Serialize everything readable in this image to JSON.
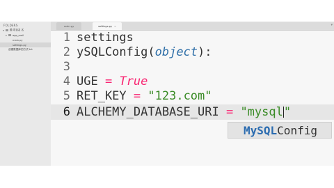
{
  "sidebar": {
    "title": "FOLDERS",
    "rows": [
      {
        "label": "题 项目名 名",
        "level": 0,
        "expanded": true
      },
      {
        "label": "app_mail",
        "level": 1,
        "expanded": true
      },
      {
        "label": "main.py",
        "level": 2
      },
      {
        "label": "settings.py",
        "level": 2,
        "selected": true
      },
      {
        "label": "创建数据库的方式.txt",
        "level": 1
      }
    ]
  },
  "tabs": [
    {
      "label": "main.py",
      "active": false
    },
    {
      "label": "settings.py",
      "active": true
    }
  ],
  "tab_close_glyph": "×",
  "tabbar_arrow_glyph": "▾",
  "editor": {
    "line_numbers": [
      "1",
      "2",
      "3",
      "4",
      "5",
      "6"
    ],
    "current_line": "6",
    "lines": {
      "l1": "settings",
      "l2_name": "ySQLConfig",
      "l2_paren_open": "(",
      "l2_param": "object",
      "l2_paren_close": "):",
      "l4_name": "UGE ",
      "l4_op": "=",
      "l4_value": "True",
      "l5_name": "RET_KEY ",
      "l5_op": "=",
      "l5_value": "\"123.com\"",
      "l6_name": "ALCHEMY_DATABASE_URI ",
      "l6_op": "=",
      "l6_value": "\"mysql",
      "l6_after_caret": "\""
    }
  },
  "autocomplete": {
    "match": "MySQL",
    "rest": "Config"
  },
  "colors": {
    "keyword": "#f92672",
    "string": "#3a8b26",
    "param": "#2f6fa8",
    "match": "#2b6cb0"
  }
}
